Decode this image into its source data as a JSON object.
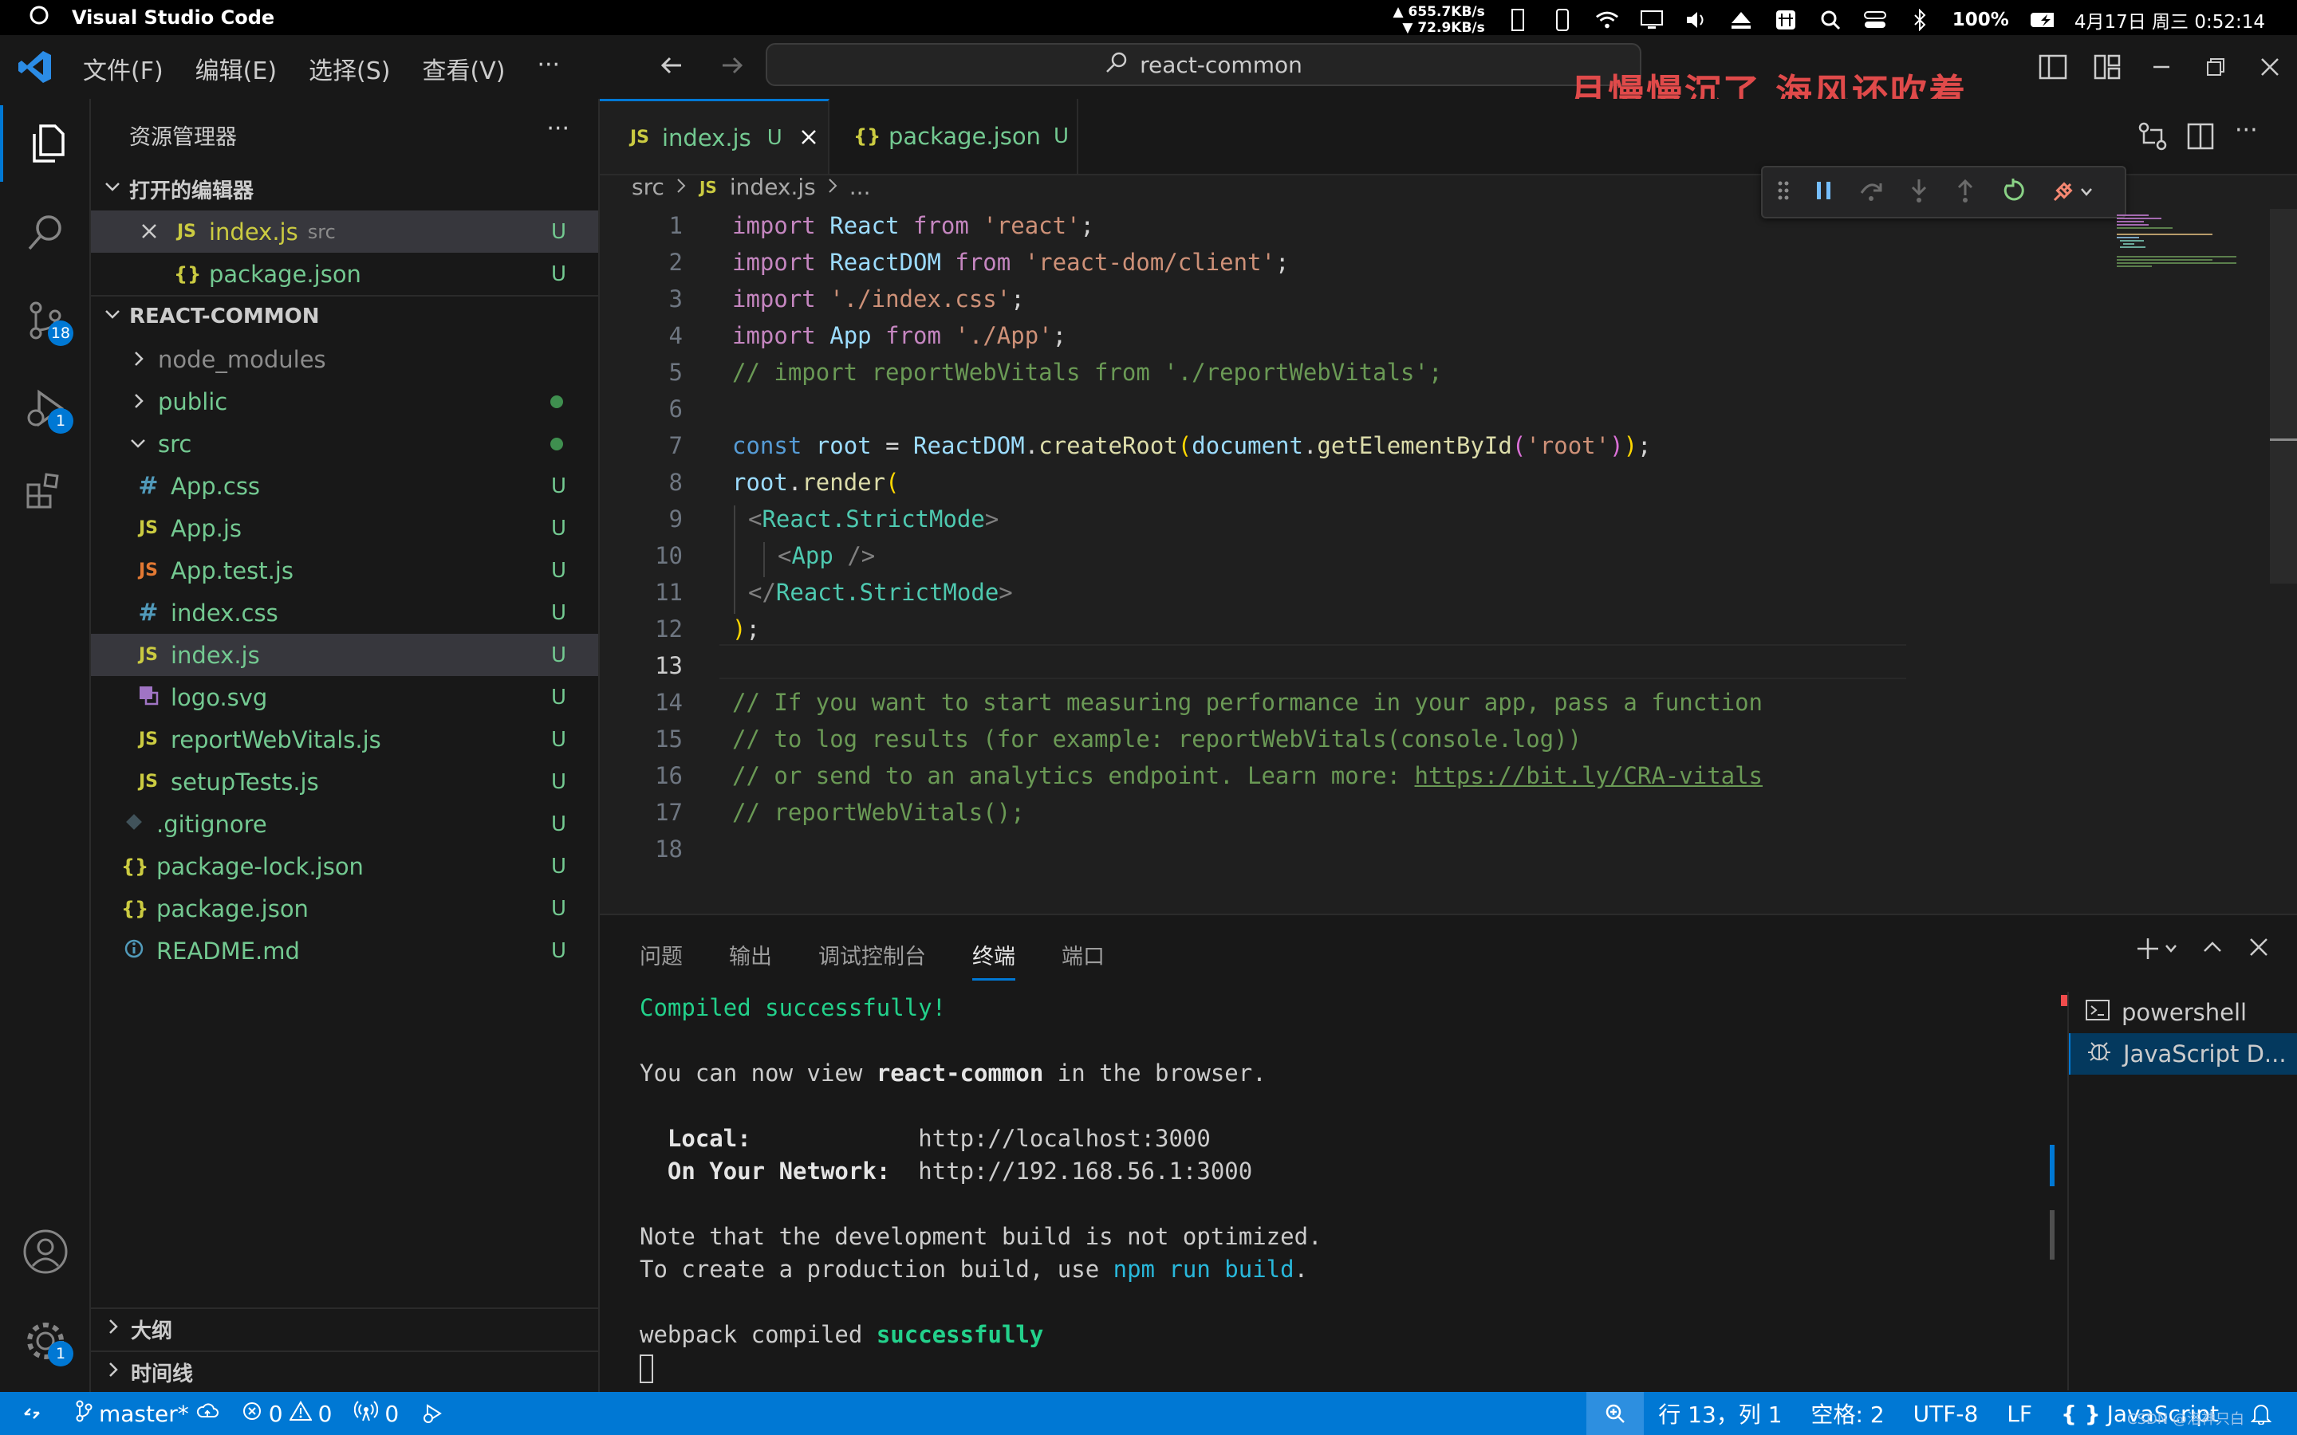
{
  "os": {
    "app_name": "Visual Studio Code",
    "net_up": "655.7KB/s",
    "net_down": "72.9KB/s",
    "battery": "100%",
    "datetime": "4月17日 周三 0:52:14"
  },
  "titlebar": {
    "menus": [
      "文件(F)",
      "编辑(E)",
      "选择(S)",
      "查看(V)",
      "···"
    ],
    "search_text": "react-common",
    "overlay_text": "月慢慢沉了 海风还吹着"
  },
  "activity": {
    "scm_badge": "18",
    "debug_badge": "1",
    "settings_badge": "1"
  },
  "sidebar": {
    "title": "资源管理器",
    "more": "···",
    "open_editors_header": "打开的编辑器",
    "open_editors": [
      {
        "name": "index.js",
        "hint": "src",
        "status": "U"
      },
      {
        "name": "package.json",
        "status": "U"
      }
    ],
    "project_header": "REACT-COMMON",
    "tree": [
      {
        "name": "node_modules"
      },
      {
        "name": "public"
      },
      {
        "name": "src"
      },
      {
        "name": "App.css",
        "status": "U"
      },
      {
        "name": "App.js",
        "status": "U"
      },
      {
        "name": "App.test.js",
        "status": "U"
      },
      {
        "name": "index.css",
        "status": "U"
      },
      {
        "name": "index.js",
        "status": "U"
      },
      {
        "name": "logo.svg",
        "status": "U"
      },
      {
        "name": "reportWebVitals.js",
        "status": "U"
      },
      {
        "name": "setupTests.js",
        "status": "U"
      },
      {
        "name": ".gitignore",
        "status": "U"
      },
      {
        "name": "package-lock.json",
        "status": "U"
      },
      {
        "name": "package.json",
        "status": "U"
      },
      {
        "name": "README.md",
        "status": "U"
      }
    ],
    "outline_header": "大纲",
    "timeline_header": "时间线"
  },
  "editor": {
    "tabs": [
      {
        "icon": "JS",
        "label": "index.js",
        "status": "U"
      },
      {
        "icon": "{ }",
        "label": "package.json",
        "status": "U"
      }
    ],
    "breadcrumb": {
      "folder": "src",
      "file": "index.js",
      "rest": "..."
    },
    "line_numbers": [
      "1",
      "2",
      "3",
      "4",
      "5",
      "6",
      "7",
      "8",
      "9",
      "10",
      "11",
      "12",
      "13",
      "14",
      "15",
      "16",
      "17",
      "18"
    ],
    "code": {
      "l1": [
        "import",
        "React",
        "from",
        "'react'",
        ";"
      ],
      "l2": [
        "import",
        "ReactDOM",
        "from",
        "'react-dom/client'",
        ";"
      ],
      "l3": [
        "import",
        "'./index.css'",
        ";"
      ],
      "l4": [
        "import",
        "App",
        "from",
        "'./App'",
        ";"
      ],
      "l5": "// import reportWebVitals from './reportWebVitals';",
      "l7": [
        "const",
        "root",
        "=",
        "ReactDOM",
        ".",
        "createRoot",
        "(",
        "document",
        ".",
        "getElementById",
        "(",
        "'root'",
        ")",
        ")",
        ";"
      ],
      "l8": [
        "root",
        ".",
        "render",
        "("
      ],
      "l9": [
        "<",
        "React.StrictMode",
        ">"
      ],
      "l10": [
        "<",
        "App",
        " />"
      ],
      "l11": [
        "</",
        "React.StrictMode",
        ">"
      ],
      "l12": [
        ")",
        ";"
      ],
      "l14": "// If you want to start measuring performance in your app, pass a function",
      "l15": "// to log results (for example: reportWebVitals(console.log))",
      "l16_prefix": "// or send to an analytics endpoint. Learn more: ",
      "l16_link": "https://bit.ly/CRA-vitals",
      "l17": "// reportWebVitals();"
    }
  },
  "panel": {
    "tabs": [
      "问题",
      "输出",
      "调试控制台",
      "终端",
      "端口"
    ],
    "active_tab": "终端",
    "terminal": {
      "line1": "Compiled successfully!",
      "line2_a": "You can now view ",
      "line2_b": "react-common",
      "line2_c": " in the browser.",
      "local_label": "Local:",
      "local_url": "http://localhost:3000",
      "network_label": "On Your Network:",
      "network_url": "http://192.168.56.1:3000",
      "note1": "Note that the development build is not optimized.",
      "note2_a": "To create a production build, use ",
      "note2_b": "npm run build",
      "note2_c": ".",
      "wp_a": "webpack compiled ",
      "wp_b": "successfully"
    },
    "terminals": [
      "powershell",
      "JavaScript D..."
    ]
  },
  "statusbar": {
    "branch": "master*",
    "errors": "0",
    "warnings": "0",
    "ports": "0",
    "position": "行 13，列 1",
    "spaces": "空格: 2",
    "encoding": "UTF-8",
    "eol": "LF",
    "language": "JavaScript",
    "watermark": "CSDN @洛神只白"
  }
}
